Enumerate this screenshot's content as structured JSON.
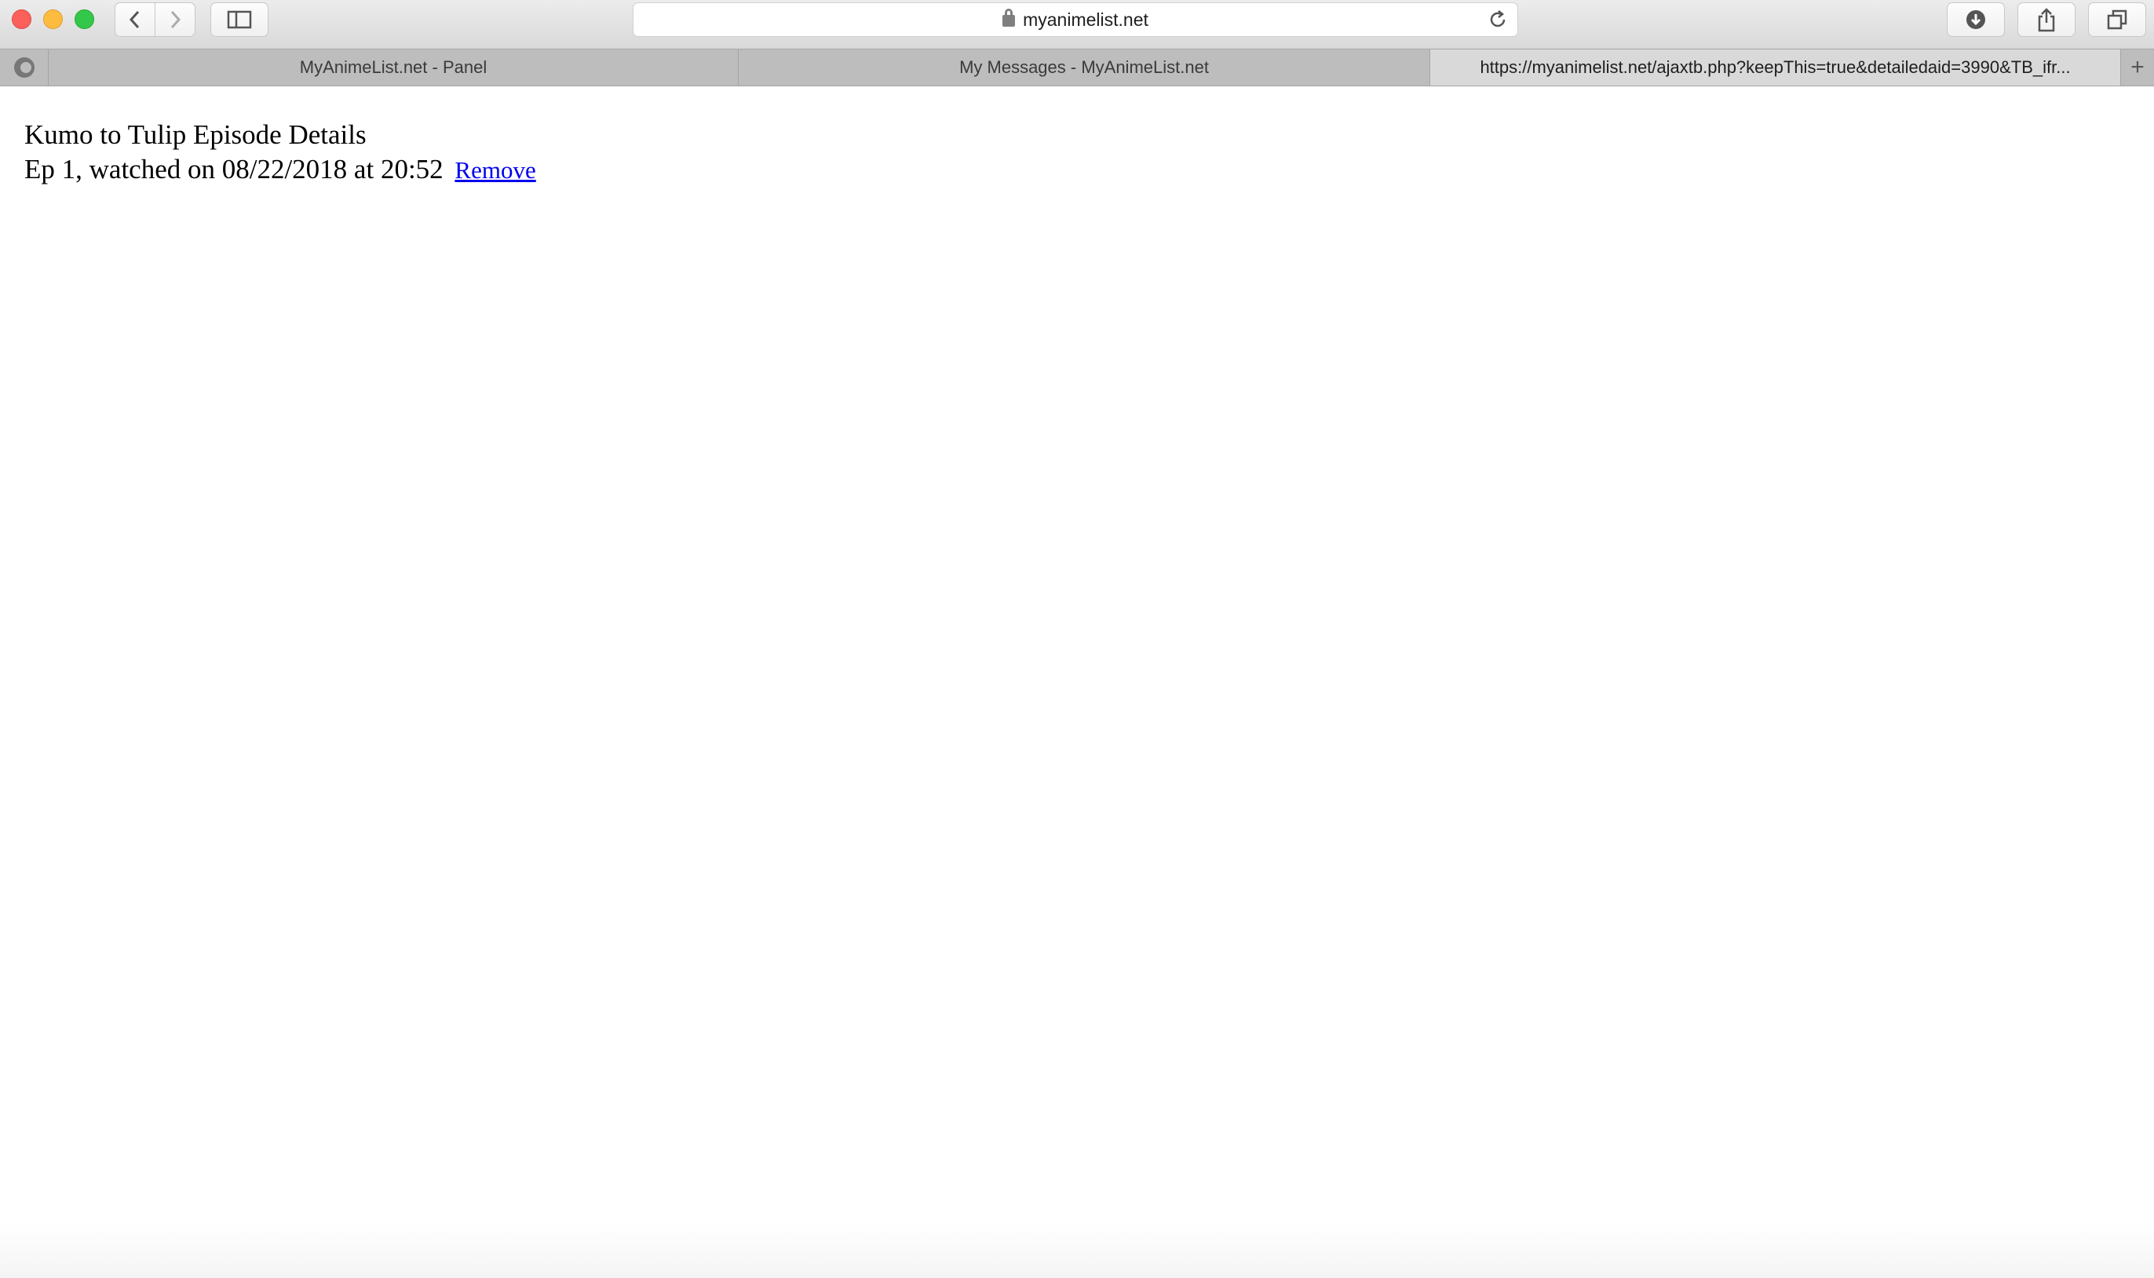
{
  "browser": {
    "address": "myanimelist.net",
    "tabs": [
      {
        "label": "MyAnimeList.net - Panel"
      },
      {
        "label": "My Messages - MyAnimeList.net"
      },
      {
        "label": "https://myanimelist.net/ajaxtb.php?keepThis=true&detailedaid=3990&TB_ifr..."
      }
    ]
  },
  "page": {
    "title": "Kumo to Tulip Episode Details",
    "episode_text": "Ep 1, watched on 08/22/2018 at 20:52",
    "remove_label": "Remove"
  }
}
